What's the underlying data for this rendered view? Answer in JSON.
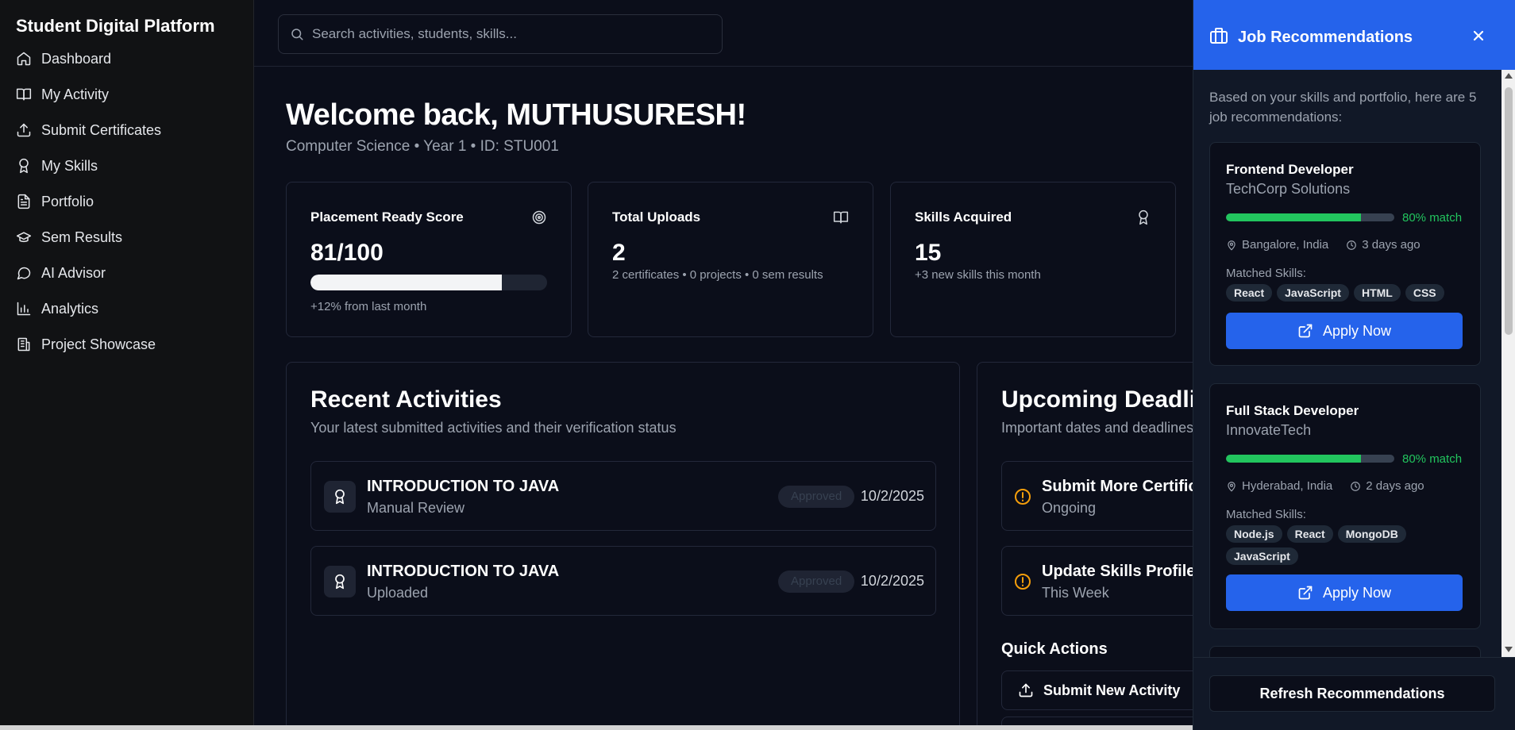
{
  "sidebar": {
    "brand": "Student Digital Platform",
    "items": [
      {
        "label": "Dashboard",
        "icon": "home-icon"
      },
      {
        "label": "My Activity",
        "icon": "book-open-icon"
      },
      {
        "label": "Submit Certificates",
        "icon": "upload-icon"
      },
      {
        "label": "My Skills",
        "icon": "award-icon"
      },
      {
        "label": "Portfolio",
        "icon": "file-text-icon"
      },
      {
        "label": "Sem Results",
        "icon": "graduation-cap-icon"
      },
      {
        "label": "AI Advisor",
        "icon": "message-circle-icon"
      },
      {
        "label": "Analytics",
        "icon": "bar-chart-icon"
      },
      {
        "label": "Project Showcase",
        "icon": "building-icon"
      }
    ]
  },
  "search": {
    "placeholder": "Search activities, students, skills..."
  },
  "header": {
    "welcome": "Welcome back, MUTHUSURESH!",
    "subtitle": "Computer Science • Year 1 • ID: STU001"
  },
  "stats": [
    {
      "title": "Placement Ready Score",
      "value": "81/100",
      "note": "+12% from last month",
      "progress": 0.81,
      "icon": "target-icon"
    },
    {
      "title": "Total Uploads",
      "value": "2",
      "note": "2 certificates • 0 projects • 0 sem results",
      "icon": "book-open-icon"
    },
    {
      "title": "Skills Acquired",
      "value": "15",
      "note": "+3 new skills this month",
      "icon": "award-icon"
    }
  ],
  "recent": {
    "title": "Recent Activities",
    "subtitle": "Your latest submitted activities and their verification status",
    "items": [
      {
        "title": "INTRODUCTION TO JAVA",
        "sub": "Manual Review",
        "status": "Approved",
        "date": "10/2/2025"
      },
      {
        "title": "INTRODUCTION TO JAVA",
        "sub": "Uploaded",
        "status": "Approved",
        "date": "10/2/2025"
      }
    ]
  },
  "deadlines": {
    "title": "Upcoming Deadlines",
    "subtitle": "Important dates and deadlines",
    "items": [
      {
        "title": "Submit More Certificates",
        "sub": "Ongoing"
      },
      {
        "title": "Update Skills Profile",
        "sub": "This Week"
      }
    ],
    "quick_actions_title": "Quick Actions",
    "quick_actions": [
      {
        "label": "Submit New Activity"
      }
    ]
  },
  "panel": {
    "title": "Job Recommendations",
    "intro": "Based on your skills and portfolio, here are 5 job recommendations:",
    "matched_label": "Matched Skills:",
    "apply_label": "Apply Now",
    "refresh_label": "Refresh Recommendations",
    "jobs": [
      {
        "title": "Frontend Developer",
        "company": "TechCorp Solutions",
        "match": 0.8,
        "match_text": "80% match",
        "location": "Bangalore, India",
        "posted": "3 days ago",
        "skills": [
          "React",
          "JavaScript",
          "HTML",
          "CSS"
        ]
      },
      {
        "title": "Full Stack Developer",
        "company": "InnovateTech",
        "match": 0.8,
        "match_text": "80% match",
        "location": "Hyderabad, India",
        "posted": "2 days ago",
        "skills": [
          "Node.js",
          "React",
          "MongoDB",
          "JavaScript"
        ]
      }
    ]
  },
  "colors": {
    "accent": "#2563eb",
    "match": "#22c55e",
    "warning": "#f59e0b",
    "background": "#0b0e1a"
  }
}
